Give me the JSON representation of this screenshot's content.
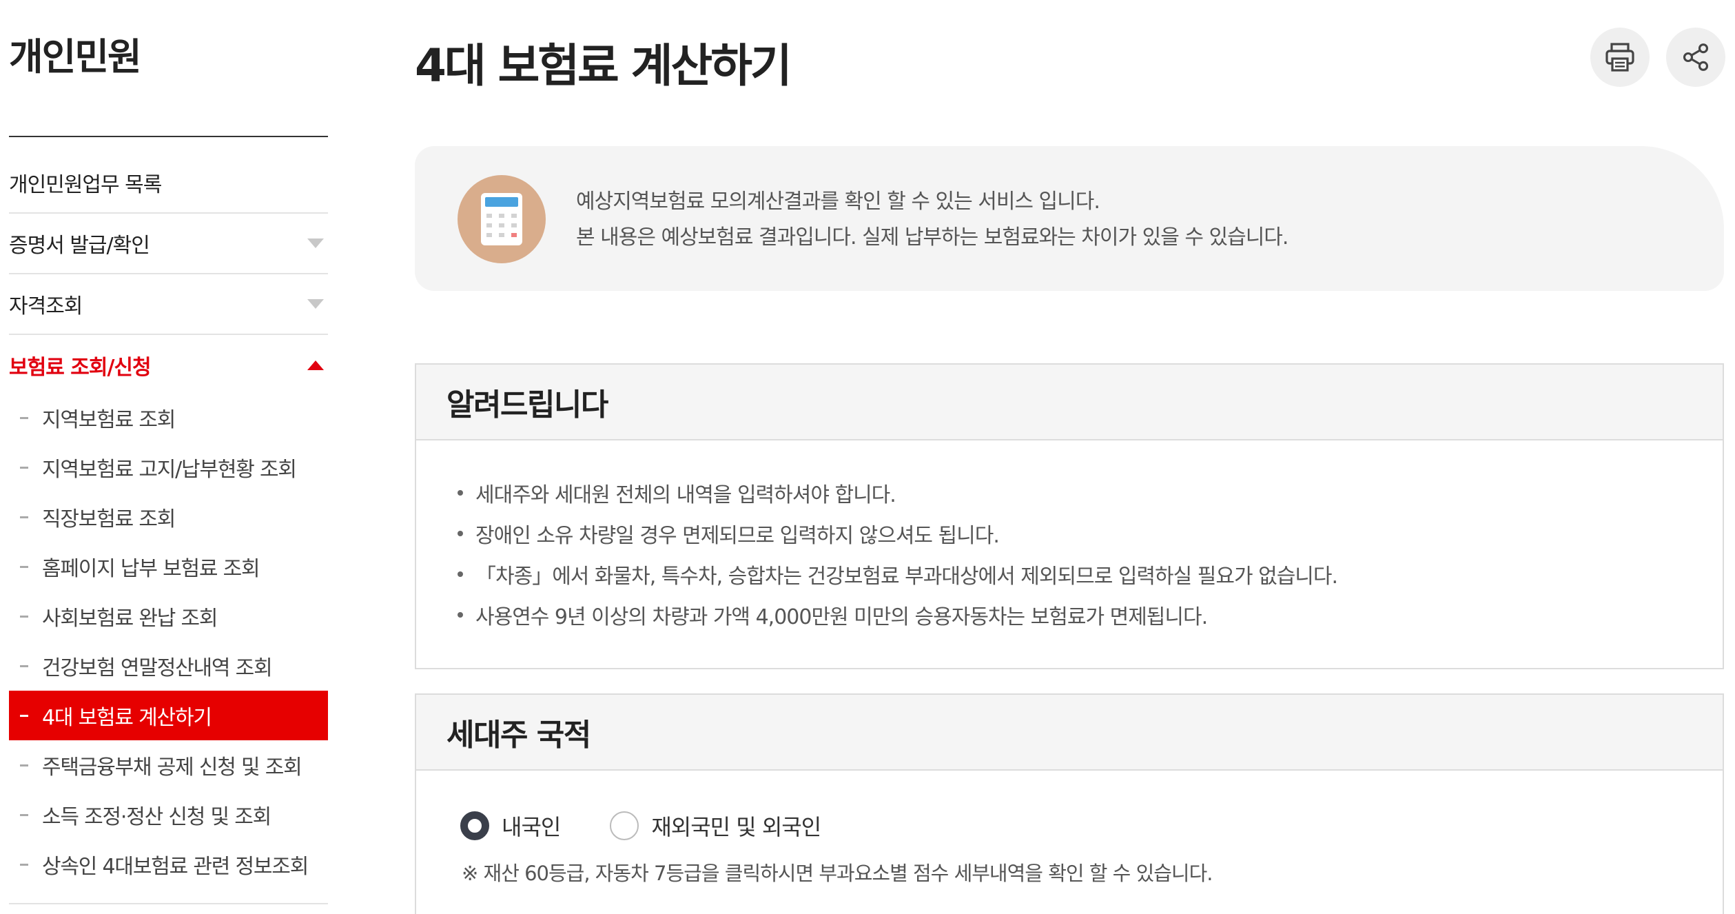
{
  "sidebar": {
    "title": "개인민원",
    "items": [
      {
        "label": "개인민원업무 목록"
      },
      {
        "label": "증명서 발급/확인"
      },
      {
        "label": "자격조회"
      },
      {
        "label": "보험료 조회/신청"
      }
    ],
    "subitems": [
      {
        "label": "지역보험료 조회"
      },
      {
        "label": "지역보험료 고지/납부현황 조회"
      },
      {
        "label": "직장보험료 조회"
      },
      {
        "label": "홈페이지 납부 보험료 조회"
      },
      {
        "label": "사회보험료 완납 조회"
      },
      {
        "label": "건강보험 연말정산내역 조회"
      },
      {
        "label": "4대 보험료 계산하기"
      },
      {
        "label": "주택금융부채 공제 신청 및 조회"
      },
      {
        "label": "소득 조정·정산 신청 및 조회"
      },
      {
        "label": "상속인 4대보험료 관련 정보조회"
      }
    ],
    "active_color": "#e60000"
  },
  "header": {
    "title": "4대 보험료 계산하기",
    "print_icon": "print-icon",
    "share_icon": "share-icon"
  },
  "banner": {
    "icon": "calculator-icon",
    "line1": "예상지역보험료 모의계산결과를 확인 할 수 있는 서비스 입니다.",
    "line2": "본 내용은 예상보험료 결과입니다. 실제 납부하는 보험료와는 차이가 있을 수 있습니다."
  },
  "notice": {
    "title": "알려드립니다",
    "items": [
      "세대주와 세대원 전체의 내역을 입력하셔야 합니다.",
      "장애인 소유 차량일 경우 면제되므로 입력하지 않으셔도 됩니다.",
      "「차종」에서 화물차, 특수차, 승합차는 건강보험료 부과대상에서 제외되므로 입력하실 필요가 없습니다.",
      "사용연수 9년 이상의 차량과 가액 4,000만원 미만의 승용자동차는 보험료가 면제됩니다."
    ]
  },
  "nationality": {
    "title": "세대주 국적",
    "options": [
      "내국인",
      "재외국민 및 외국인"
    ],
    "selected": "내국인",
    "note": "※ 재산 60등급, 자동차 7등급을 클릭하시면 부과요소별 점수 세부내역을 확인 할 수 있습니다."
  }
}
